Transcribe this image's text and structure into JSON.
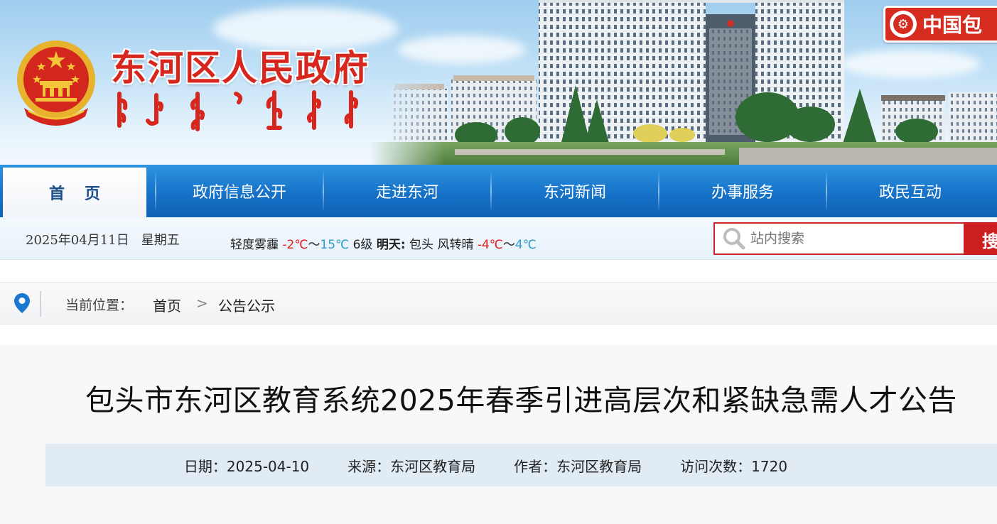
{
  "banner": {
    "site_name": "东河区人民政府",
    "badge_text": "中国包"
  },
  "nav": {
    "items": [
      {
        "label": "首页"
      },
      {
        "label": "政府信息公开"
      },
      {
        "label": "走进东河"
      },
      {
        "label": "东河新闻"
      },
      {
        "label": "办事服务"
      },
      {
        "label": "政民互动"
      }
    ]
  },
  "info": {
    "date": "2025年04月11日",
    "weekday": "星期五",
    "weather_desc": "轻度雾霾",
    "temp_low": "-2℃",
    "tilde1": "～",
    "temp_high": "15℃",
    "wind": "6级",
    "tomorrow_label": "明天:",
    "tomorrow_city": "包头",
    "tomorrow_desc": "风转晴",
    "tomorrow_low": "-4℃",
    "tilde2": "～",
    "tomorrow_high": "4℃"
  },
  "search": {
    "placeholder": "站内搜索",
    "button_label": "搜"
  },
  "breadcrumb": {
    "label": "当前位置：",
    "home": "首页",
    "arrow": ">",
    "current": "公告公示"
  },
  "article": {
    "title": "包头市东河区教育系统2025年春季引进高层次和紧缺急需人才公告",
    "date": "日期：2025-04-10",
    "source": "来源：东河区教育局",
    "author": "作者：东河区教育局",
    "views": "访问次数：1720"
  },
  "colors": {
    "nav_blue": "#1672c8",
    "brand_red": "#d7261e",
    "temp_hot": "#e01b1b",
    "temp_cold": "#2f9cc9",
    "meta_bg": "#e1ebf3"
  },
  "icons": {
    "emblem": "national-emblem-icon",
    "search": "search-icon",
    "location": "location-pin-icon"
  }
}
